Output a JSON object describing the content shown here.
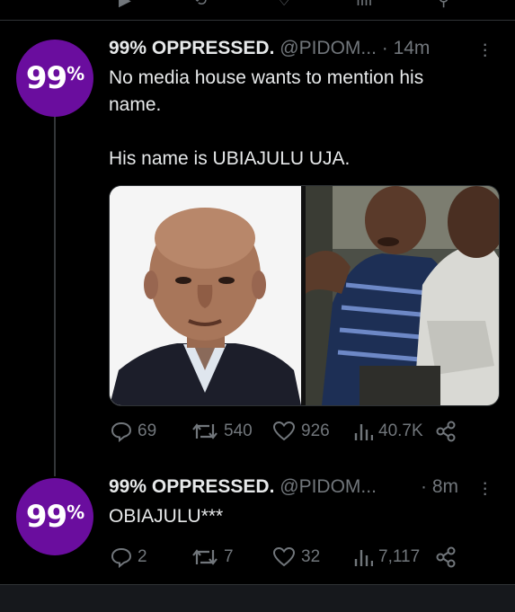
{
  "tweets": [
    {
      "avatar_text": "99",
      "avatar_pct": "%",
      "name": "99% OPPRESSED.",
      "handle": "@PIDOM...",
      "time": "· 14m",
      "text": "No media house wants to mention his\nname.\n\nHis name is UBIAJULU UJA.",
      "replies": "69",
      "retweets": "540",
      "likes": "926",
      "views": "40.7K"
    },
    {
      "avatar_text": "99",
      "avatar_pct": "%",
      "name": "99% OPPRESSED.",
      "handle": "@PIDOM...",
      "time": "· 8m",
      "text": "OBIAJULU***",
      "replies": "2",
      "retweets": "7",
      "likes": "32",
      "views": "7,117"
    }
  ],
  "colors": {
    "accent": "#6a0d9e",
    "muted": "#71767b",
    "text": "#e7e9ea"
  },
  "icons": [
    "reply-icon",
    "retweet-icon",
    "like-icon",
    "views-icon",
    "share-icon",
    "more-icon"
  ]
}
